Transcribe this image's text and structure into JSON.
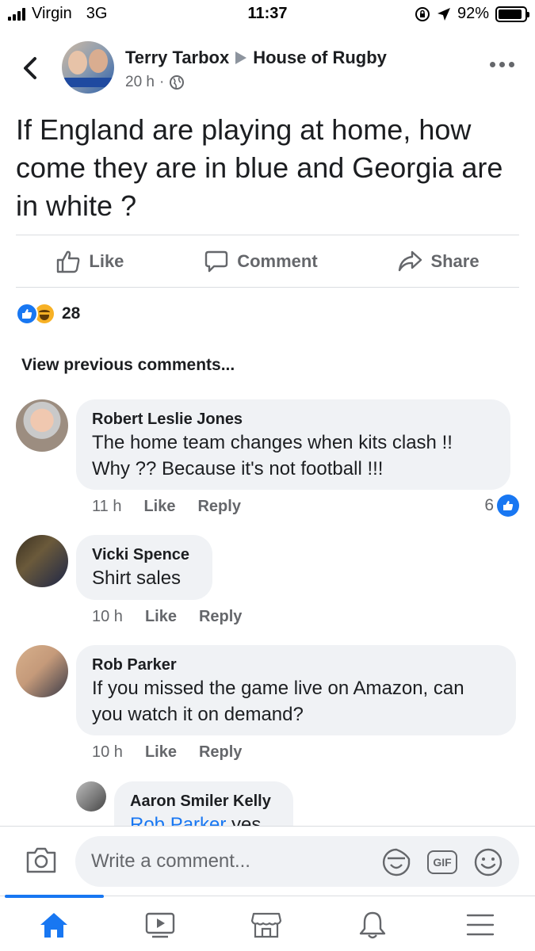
{
  "status_bar": {
    "carrier": "Virgin",
    "network": "3G",
    "time": "11:37",
    "battery": "92%",
    "battery_level": 0.92
  },
  "post": {
    "author": "Terry Tarbox",
    "group": "House of Rugby",
    "time": "20 h",
    "text": "If England are playing at home, how come they are in blue and Georgia are in white ?",
    "reaction_count": "28"
  },
  "actions": {
    "like": "Like",
    "comment": "Comment",
    "share": "Share"
  },
  "view_previous": "View previous comments...",
  "comments": [
    {
      "author": "Robert Leslie Jones",
      "text_line1": "The home team changes when  kits clash !!",
      "text_line2": "Why ??  Because it's not football   !!!",
      "time": "11 h",
      "like": "Like",
      "reply": "Reply",
      "likes": "6"
    },
    {
      "author": "Vicki Spence",
      "text": "Shirt sales",
      "time": "10 h",
      "like": "Like",
      "reply": "Reply"
    },
    {
      "author": "Rob Parker",
      "text_line1": "If you missed the game live on Amazon, can",
      "text_line2": "you watch it on demand?",
      "time": "10 h",
      "like": "Like",
      "reply": "Reply"
    },
    {
      "author": "Aaron Smiler Kelly",
      "mention": "Rob Parker",
      "text": " yes"
    }
  ],
  "composer": {
    "placeholder": "Write a comment...",
    "gif_label": "GIF"
  },
  "colors": {
    "accent": "#1877f2",
    "bubble": "#f0f2f5",
    "secondary_text": "#65676b"
  },
  "icons": [
    "back-icon",
    "globe-icon",
    "more-icon",
    "like-icon",
    "comment-icon",
    "share-icon",
    "camera-icon",
    "sticker-icon",
    "gif-icon",
    "emoji-icon",
    "home-icon",
    "watch-icon",
    "marketplace-icon",
    "bell-icon",
    "menu-icon"
  ]
}
